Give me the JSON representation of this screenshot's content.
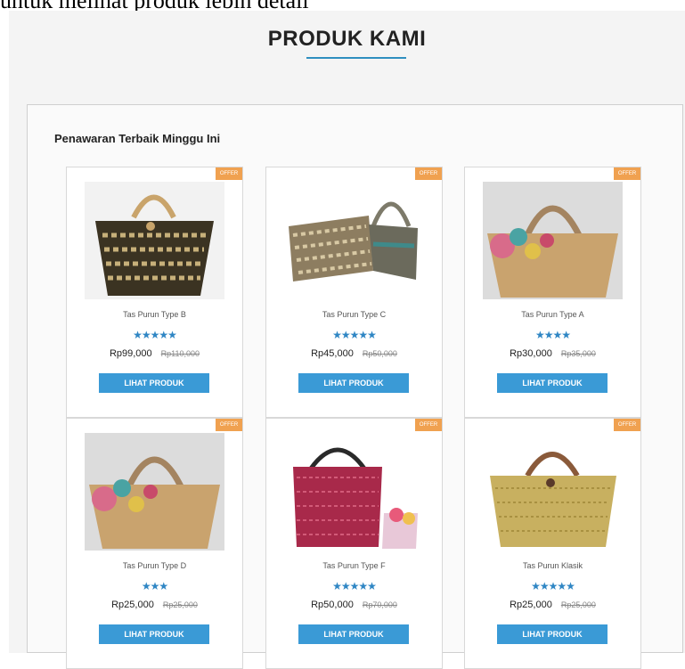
{
  "top_text": "untuk melihat produk lebih detail",
  "section": {
    "title": "PRODUK KAMI",
    "panel_title": "Penawaran Terbaik Minggu Ini"
  },
  "products": [
    {
      "badge": "OFFER",
      "name": "Tas Purun Type B",
      "stars": "★★★★★",
      "rating": 5,
      "price": "Rp99,000",
      "old_price": "Rp110,000",
      "button": "LIHAT PRODUK"
    },
    {
      "badge": "OFFER",
      "name": "Tas Purun Type C",
      "stars": "★★★★★",
      "rating": 5,
      "price": "Rp45,000",
      "old_price": "Rp50,000",
      "button": "LIHAT PRODUK"
    },
    {
      "badge": "OFFER",
      "name": "Tas Purun Type A",
      "stars": "★★★★",
      "rating": 4,
      "price": "Rp30,000",
      "old_price": "Rp35,000",
      "button": "LIHAT PRODUK"
    },
    {
      "badge": "OFFER",
      "name": "Tas Purun Type D",
      "stars": "★★★",
      "rating": 3,
      "price": "Rp25,000",
      "old_price": "Rp25,000",
      "button": "LIHAT PRODUK"
    },
    {
      "badge": "OFFER",
      "name": "Tas Purun Type F",
      "stars": "★★★★★",
      "rating": 5,
      "price": "Rp50,000",
      "old_price": "Rp70,000",
      "button": "LIHAT PRODUK"
    },
    {
      "badge": "OFFER",
      "name": "Tas Purun Klasik",
      "stars": "★★★★★",
      "rating": 5,
      "price": "Rp25,000",
      "old_price": "Rp25,000",
      "button": "LIHAT PRODUK"
    }
  ]
}
